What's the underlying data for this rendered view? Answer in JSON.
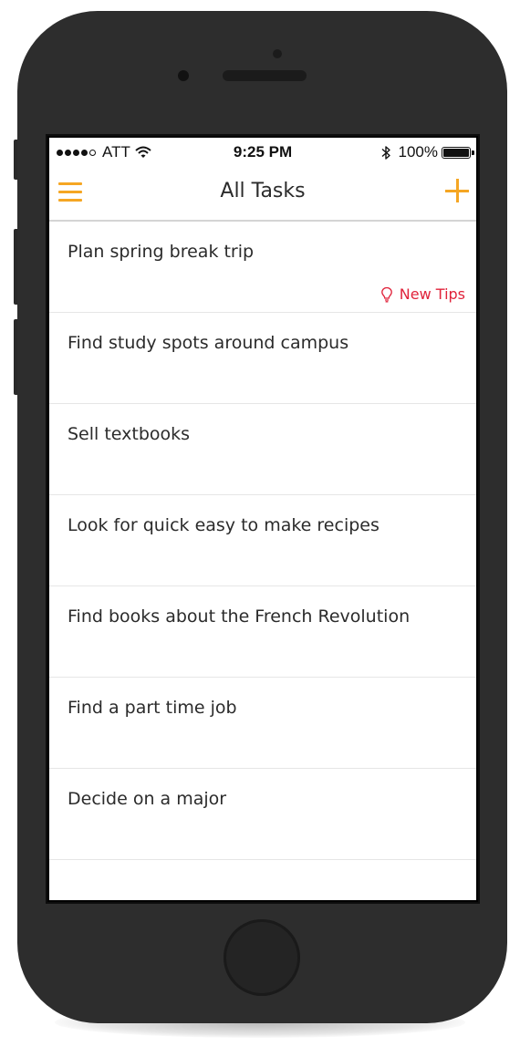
{
  "status_bar": {
    "carrier": "ATT",
    "time": "9:25 PM",
    "battery": "100%",
    "signal_bars_filled": 4,
    "signal_bars_total": 5
  },
  "nav": {
    "title": "All Tasks",
    "menu_icon": "hamburger-menu-icon",
    "add_icon": "plus-icon"
  },
  "tasks": [
    {
      "label": "Plan spring break trip",
      "tip": "New Tips"
    },
    {
      "label": "Find study spots around campus"
    },
    {
      "label": "Sell textbooks"
    },
    {
      "label": "Look for quick easy to make recipes"
    },
    {
      "label": "Find books about the French Revolution"
    },
    {
      "label": "Find a part time job"
    },
    {
      "label": "Decide on a major"
    }
  ],
  "colors": {
    "accent": "#f5a623",
    "tips": "#e0223a",
    "device": "#2d2d2d"
  }
}
